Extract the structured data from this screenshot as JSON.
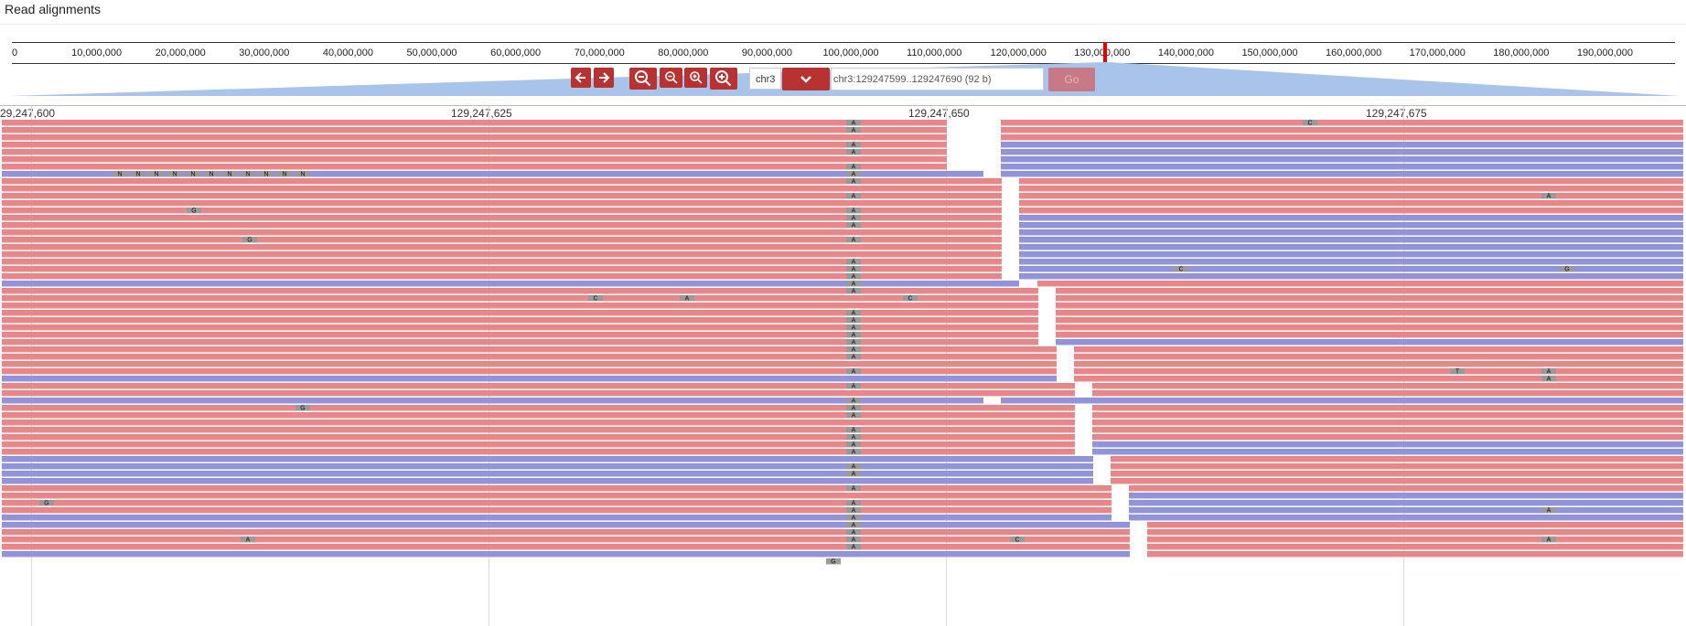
{
  "title": "Read alignments",
  "overview": {
    "ticks": [
      "0",
      "10,000,000",
      "20,000,000",
      "30,000,000",
      "40,000,000",
      "50,000,000",
      "60,000,000",
      "70,000,000",
      "80,000,000",
      "90,000,000",
      "100,000,000",
      "110,000,000",
      "120,000,000",
      "130,000,000",
      "140,000,000",
      "150,000,000",
      "160,000,000",
      "170,000,000",
      "180,000,000",
      "190,000,000"
    ]
  },
  "nav": {
    "chromosome": "chr3",
    "location": "chr3:129247599..129247690 (92 b)",
    "go_label": "Go",
    "icons": [
      "left-arrow-icon",
      "right-arrow-icon",
      "zoom-out-more-icon",
      "zoom-out-icon",
      "zoom-in-icon",
      "zoom-in-more-icon",
      "chevron-down-icon"
    ]
  },
  "ruler": {
    "labels": [
      "29,247,600",
      "129,247,625",
      "129,247,650",
      "129,247,675"
    ]
  },
  "colors": {
    "forward_read": "#e8878a",
    "reverse_read": "#9294d9",
    "mismatch_box": "#9a9a9a",
    "accent": "#b83232",
    "locus_marker": "#e00000"
  },
  "reads": {
    "mismatch_bases": [
      "A",
      "C",
      "G",
      "T",
      "N"
    ]
  }
}
